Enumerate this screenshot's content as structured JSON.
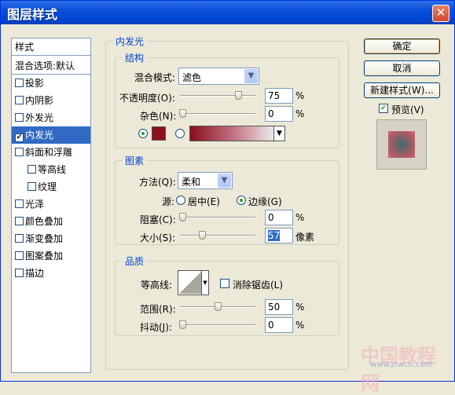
{
  "window": {
    "title": "图层样式",
    "close_icon": "close-icon"
  },
  "left_panel": {
    "header": "样式",
    "blend_options": "混合选项:默认",
    "items": [
      {
        "label": "投影",
        "checked": false
      },
      {
        "label": "内阴影",
        "checked": false
      },
      {
        "label": "外发光",
        "checked": false
      },
      {
        "label": "内发光",
        "checked": true
      },
      {
        "label": "斜面和浮雕",
        "checked": false
      },
      {
        "label": "等高线",
        "checked": false
      },
      {
        "label": "纹理",
        "checked": false
      },
      {
        "label": "光泽",
        "checked": false
      },
      {
        "label": "颜色叠加",
        "checked": false
      },
      {
        "label": "渐变叠加",
        "checked": false
      },
      {
        "label": "图案叠加",
        "checked": false
      },
      {
        "label": "描边",
        "checked": false
      }
    ],
    "checkmark": "✔"
  },
  "inner_glow": {
    "title": "内发光",
    "structure": {
      "title": "结构",
      "blend_mode_label": "混合模式:",
      "blend_mode_value": "滤色",
      "opacity_label": "不透明度(O):",
      "opacity_value": "75",
      "noise_label": "杂色(N):",
      "noise_value": "0",
      "percent": "%",
      "color_swatch": "#8b0f1e"
    },
    "elements": {
      "title": "图素",
      "technique_label": "方法(Q):",
      "technique_value": "柔和",
      "source_label": "源:",
      "source_center": "居中(E)",
      "source_edge": "边缘(G)",
      "choke_label": "阻塞(C):",
      "choke_value": "0",
      "size_label": "大小(S):",
      "size_value": "57",
      "size_unit": "像素",
      "percent": "%"
    },
    "quality": {
      "title": "品质",
      "contour_label": "等高线:",
      "anti_alias_label": "消除锯齿(L)",
      "range_label": "范围(R):",
      "range_value": "50",
      "jitter_label": "抖动(J):",
      "jitter_value": "0",
      "percent": "%"
    }
  },
  "buttons": {
    "ok": "确定",
    "cancel": "取消",
    "new_style": "新建样式(W)...",
    "preview_label": "预览(V)",
    "preview_checked": true
  },
  "watermark": {
    "line1": "中国教程网",
    "line2": "www.jcwcn.com"
  }
}
